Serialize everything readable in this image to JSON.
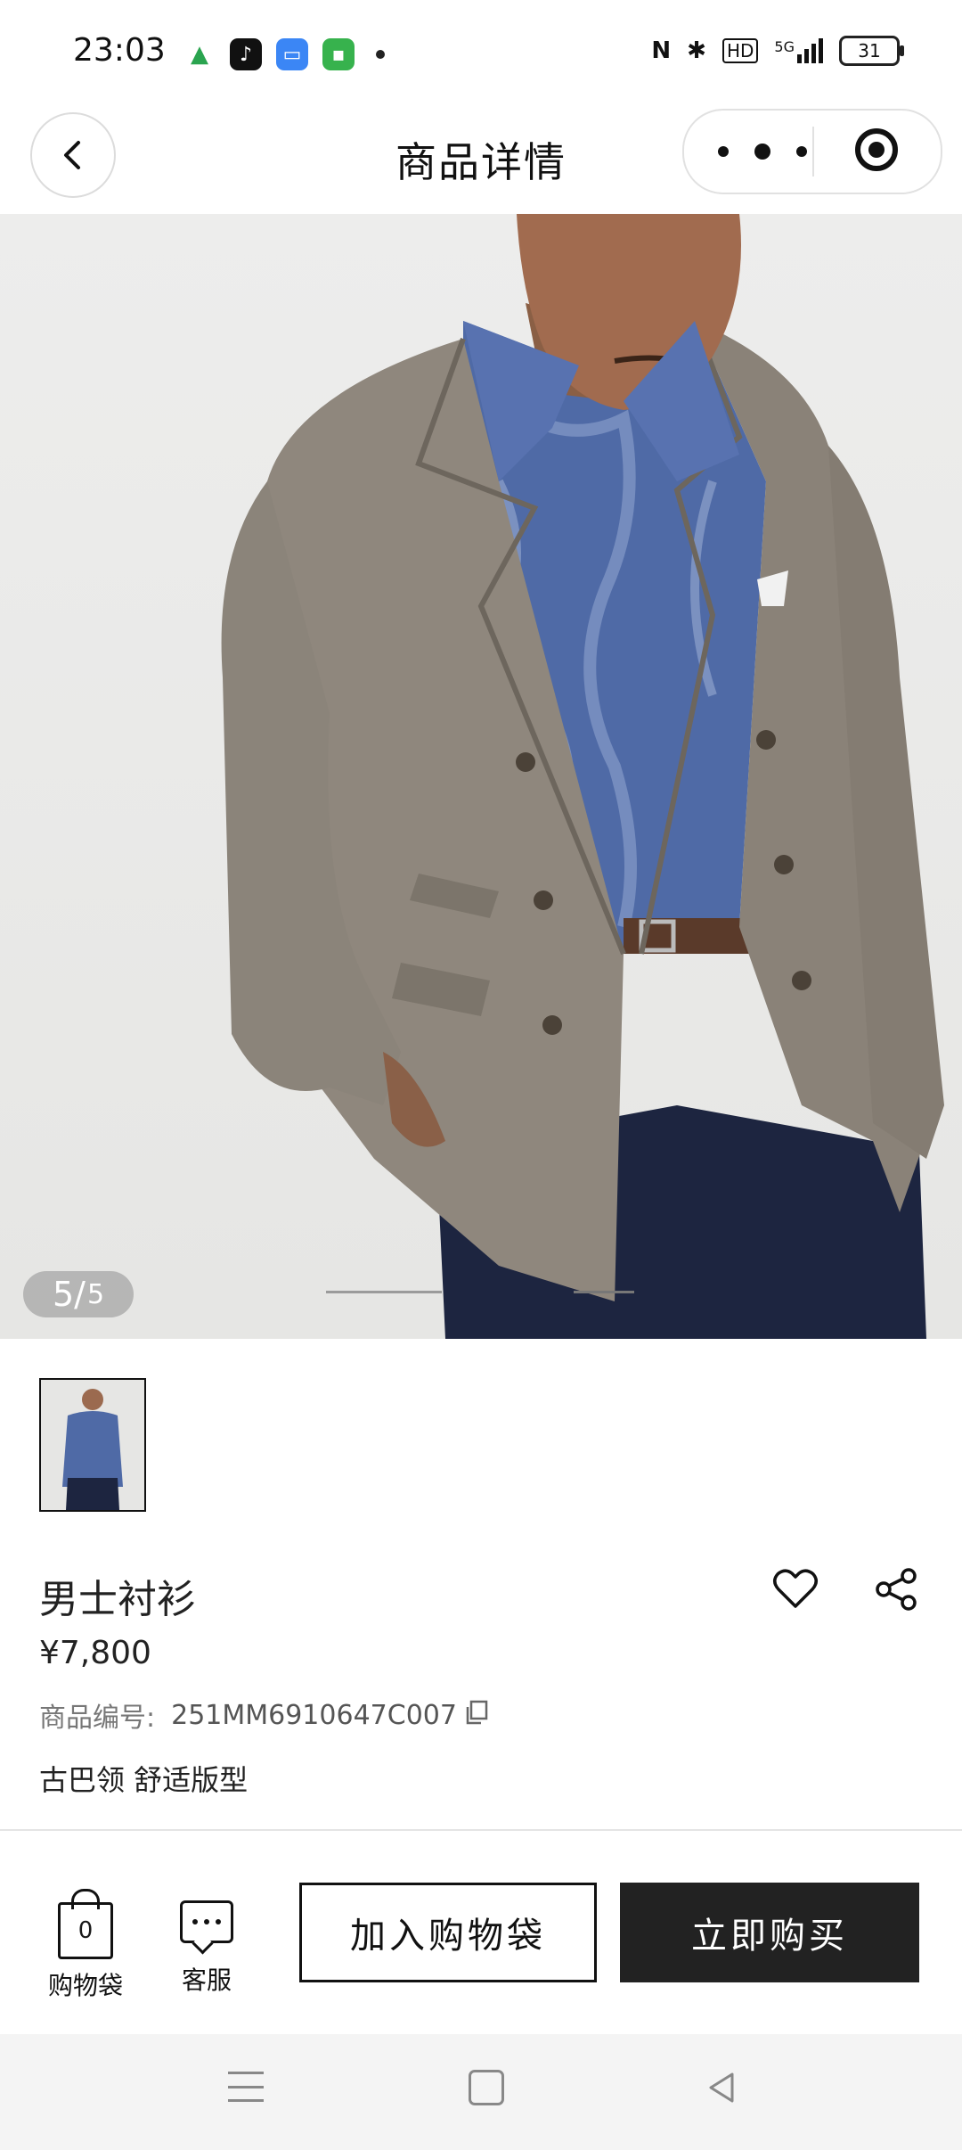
{
  "status_bar": {
    "time": "23:03",
    "network": "5G",
    "hd": "HD",
    "battery": "31",
    "icons": [
      "app-notification-icon",
      "tiktok-icon",
      "files-icon",
      "wallet-icon",
      "nfc-icon",
      "bluetooth-icon",
      "signal-icon"
    ]
  },
  "nav": {
    "title": "商品详情",
    "back_icon": "chevron-left-icon",
    "more_icon": "more-dots-icon",
    "close_icon": "target-icon"
  },
  "gallery": {
    "current": "5",
    "separator": "/",
    "total": "5",
    "current_index": 5,
    "count": 5
  },
  "product": {
    "name": "男士衬衫",
    "price": "¥7,800",
    "sku_label": "商品编号:",
    "sku_value": "251MM6910647C007",
    "features": "古巴领 舒适版型"
  },
  "actions": {
    "bag_count": "0",
    "bag_label": "购物袋",
    "service_label": "客服",
    "add_to_cart": "加入购物袋",
    "buy_now": "立即购买"
  },
  "colors": {
    "accent_dark": "#222222",
    "background": "#ffffff",
    "muted_text": "#777777"
  }
}
